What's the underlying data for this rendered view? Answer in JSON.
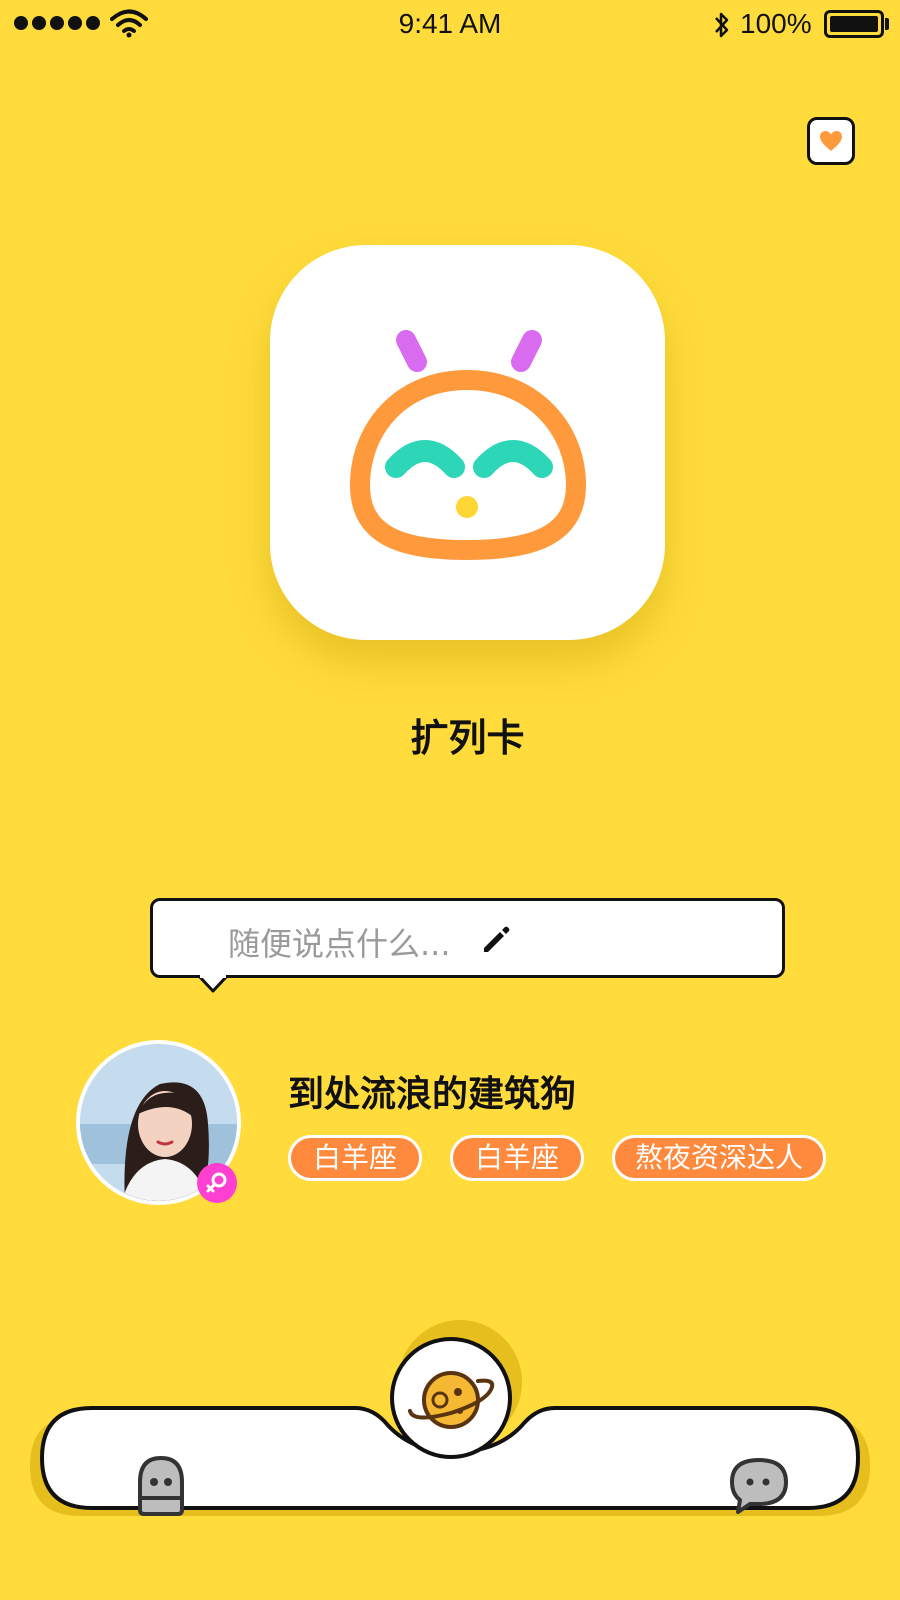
{
  "status_bar": {
    "time": "9:41 AM",
    "battery": "100%"
  },
  "app": {
    "name": "扩列卡"
  },
  "composer": {
    "placeholder": "随便说点什么..."
  },
  "profile": {
    "username": "到处流浪的建筑狗",
    "tags": [
      "白羊座",
      "白羊座",
      "熬夜资深达人"
    ]
  },
  "colors": {
    "background": "#FFDB3B",
    "accent_orange": "#FF8A3D",
    "gender_pink": "#FF3FD2",
    "mascot_purple": "#D96BF0",
    "mascot_teal": "#2ED6B8"
  },
  "icons": {
    "favorite": "heart-icon",
    "edit": "pencil-icon",
    "profile_tab": "ghost-icon",
    "explore_tab": "planet-icon",
    "chat_tab": "chat-bubble-icon",
    "gender": "female-icon"
  }
}
